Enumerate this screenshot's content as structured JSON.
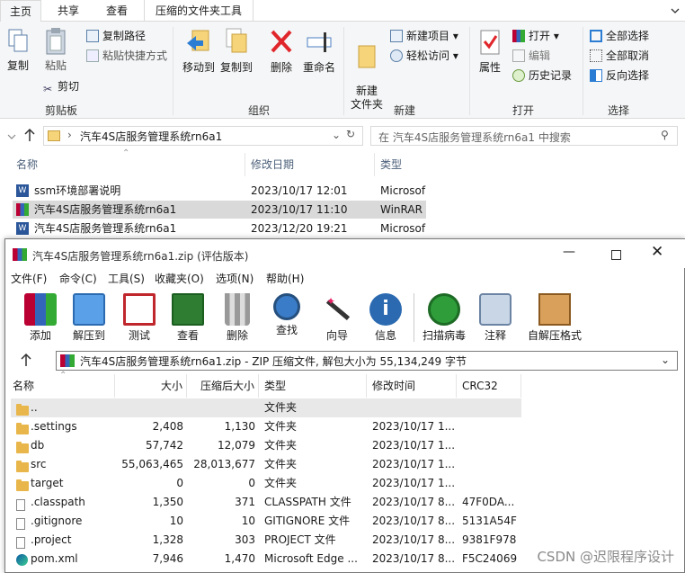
{
  "explorer": {
    "tabs": [
      "主页",
      "共享",
      "查看",
      "压缩的文件夹工具"
    ],
    "ribbon": {
      "clipboard": {
        "copy": "复制",
        "paste": "粘贴",
        "copy_path": "复制路径",
        "paste_shortcut": "粘贴快捷方式",
        "cut": "剪切",
        "label": "剪贴板"
      },
      "organize": {
        "move_to": "移动到",
        "copy_to": "复制到",
        "delete": "删除",
        "rename": "重命名",
        "label": "组织"
      },
      "new": {
        "new_folder": "新建\n文件夹",
        "new_item": "新建项目",
        "easy_access": "轻松访问",
        "label": "新建"
      },
      "open": {
        "properties": "属性",
        "open": "打开",
        "edit": "编辑",
        "history": "历史记录",
        "label": "打开"
      },
      "select": {
        "select_all": "全部选择",
        "select_none": "全部取消",
        "invert": "反向选择",
        "label": "选择"
      }
    },
    "address": "汽车4S店服务管理系统rn6a1",
    "search_placeholder": "在 汽车4S店服务管理系统rn6a1 中搜索",
    "columns": [
      "名称",
      "修改日期",
      "类型"
    ],
    "files": [
      {
        "name": "ssm环境部署说明",
        "date": "2023/10/17 12:01",
        "type": "Microsof"
      },
      {
        "name": "汽车4S店服务管理系统rn6a1",
        "date": "2023/10/17 11:10",
        "type": "WinRAR"
      },
      {
        "name": "汽车4S店服务管理系统rn6a1",
        "date": "2023/12/20 19:21",
        "type": "Microsof"
      }
    ]
  },
  "winrar": {
    "title": "汽车4S店服务管理系统rn6a1.zip (评估版本)",
    "menu": [
      "文件(F)",
      "命令(C)",
      "工具(S)",
      "收藏夹(O)",
      "选项(N)",
      "帮助(H)"
    ],
    "toolbar": [
      "添加",
      "解压到",
      "测试",
      "查看",
      "删除",
      "查找",
      "向导",
      "信息",
      "扫描病毒",
      "注释",
      "自解压格式"
    ],
    "path": "汽车4S店服务管理系统rn6a1.zip - ZIP 压缩文件, 解包大小为 55,134,249 字节",
    "columns": [
      "名称",
      "大小",
      "压缩后大小",
      "类型",
      "修改时间",
      "CRC32"
    ],
    "rows": [
      {
        "name": "..",
        "size": "",
        "packed": "",
        "type": "文件夹",
        "mtime": "",
        "crc": "",
        "icon": "up"
      },
      {
        "name": ".settings",
        "size": "2,408",
        "packed": "1,130",
        "type": "文件夹",
        "mtime": "2023/10/17 1...",
        "crc": "",
        "icon": "folder"
      },
      {
        "name": "db",
        "size": "57,742",
        "packed": "12,079",
        "type": "文件夹",
        "mtime": "2023/10/17 1...",
        "crc": "",
        "icon": "folder"
      },
      {
        "name": "src",
        "size": "55,063,465",
        "packed": "28,013,677",
        "type": "文件夹",
        "mtime": "2023/10/17 1...",
        "crc": "",
        "icon": "folder"
      },
      {
        "name": "target",
        "size": "0",
        "packed": "0",
        "type": "文件夹",
        "mtime": "2023/10/17 1...",
        "crc": "",
        "icon": "folder"
      },
      {
        "name": ".classpath",
        "size": "1,350",
        "packed": "371",
        "type": "CLASSPATH 文件",
        "mtime": "2023/10/17 8...",
        "crc": "47F0DA...",
        "icon": "doc"
      },
      {
        "name": ".gitignore",
        "size": "10",
        "packed": "10",
        "type": "GITIGNORE 文件",
        "mtime": "2023/10/17 8...",
        "crc": "5131A54F",
        "icon": "doc"
      },
      {
        "name": ".project",
        "size": "1,328",
        "packed": "303",
        "type": "PROJECT 文件",
        "mtime": "2023/10/17 8...",
        "crc": "9381F978",
        "icon": "doc"
      },
      {
        "name": "pom.xml",
        "size": "7,946",
        "packed": "1,470",
        "type": "Microsoft Edge ...",
        "mtime": "2023/10/17 8...",
        "crc": "F5C24069",
        "icon": "edge"
      }
    ]
  },
  "watermark": "CSDN @迟限程序设计",
  "colors": {
    "accent": "#0063b1",
    "selected": "#d9d9d9",
    "folder": "#e8b64a"
  }
}
